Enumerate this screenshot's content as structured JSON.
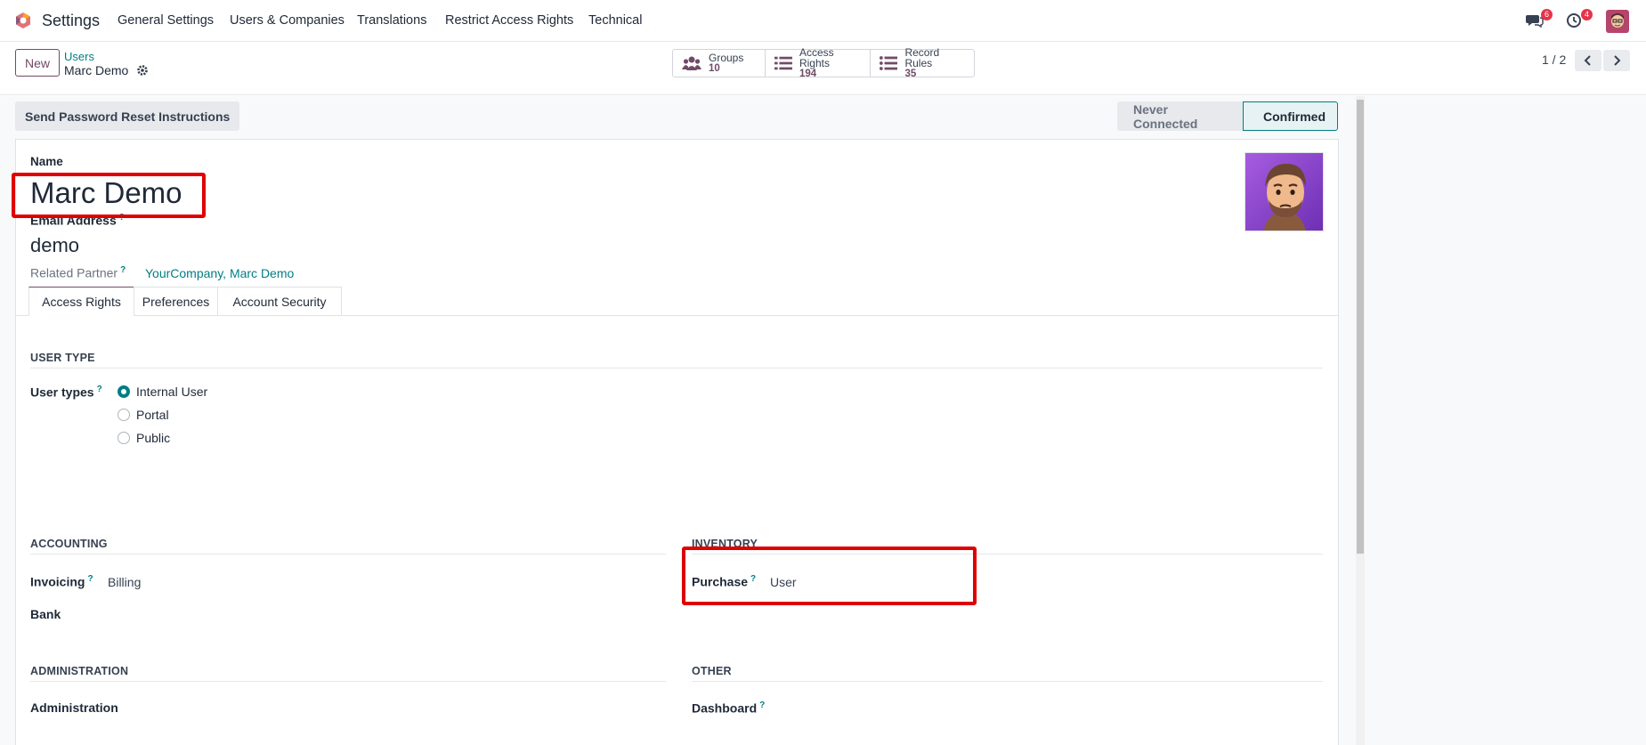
{
  "topnav": {
    "app_name": "Settings",
    "menu": [
      "General Settings",
      "Users & Companies",
      "Translations",
      "Restrict Access Rights",
      "Technical"
    ],
    "messages_count": "6",
    "activities_count": "4",
    "icons": {
      "logo": "odoo-logo-icon",
      "messages": "chat-icon",
      "activities": "clock-icon",
      "avatar": "user-avatar"
    }
  },
  "control": {
    "new_label": "New",
    "breadcrumb_parent": "Users",
    "breadcrumb_current": "Marc Demo",
    "smart_buttons": [
      {
        "label": "Groups",
        "value": "10",
        "icon": "users-icon"
      },
      {
        "label": "Access Rights",
        "value": "194",
        "icon": "list-icon"
      },
      {
        "label": "Record Rules",
        "value": "35",
        "icon": "list-icon"
      }
    ],
    "pager": "1 / 2"
  },
  "form": {
    "reset_button": "Send Password Reset Instructions",
    "status": {
      "stage1": "Never Connected",
      "stage2": "Confirmed",
      "active": "Confirmed"
    },
    "name_label": "Name",
    "name_value": "Marc Demo",
    "email_label": "Email Address",
    "email_value": "demo",
    "help_mark": "?",
    "partner_label": "Related Partner",
    "partner_value": "YourCompany, Marc Demo",
    "tabs": [
      "Access Rights",
      "Preferences",
      "Account Security"
    ],
    "active_tab": "Access Rights",
    "user_type_title": "USER TYPE",
    "user_types_label": "User types",
    "user_types": [
      "Internal User",
      "Portal",
      "Public"
    ],
    "user_type_selected": "Internal User",
    "accounting_title": "ACCOUNTING",
    "invoicing_label": "Invoicing",
    "invoicing_value": "Billing",
    "bank_label": "Bank",
    "inventory_title": "INVENTORY",
    "purchase_label": "Purchase",
    "purchase_value": "User",
    "administration_title": "ADMINISTRATION",
    "administration_label": "Administration",
    "other_title": "OTHER",
    "dashboard_label": "Dashboard"
  },
  "colors": {
    "brand": "#714b67",
    "accent": "#017e84",
    "highlight": "#e00000"
  }
}
